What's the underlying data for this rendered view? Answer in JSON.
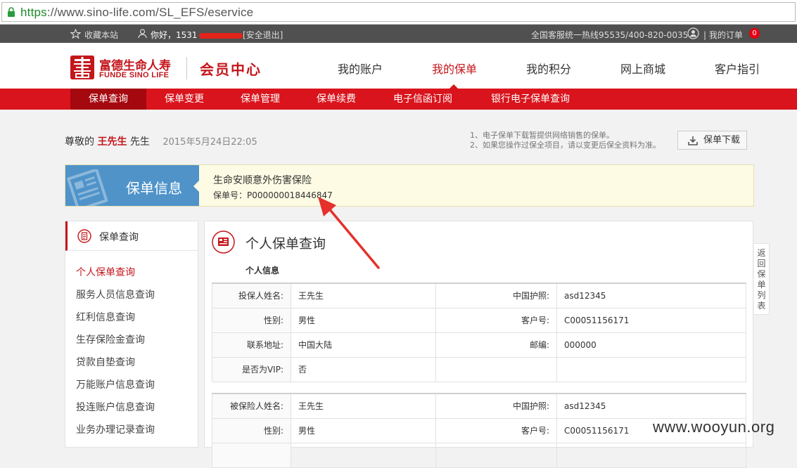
{
  "browser": {
    "url_scheme": "https",
    "url_rest": "://www.sino-life.com/SL_EFS/eservice"
  },
  "topbar": {
    "favorite": "收藏本站",
    "greeting": "你好，1531",
    "logout": "[安全退出]",
    "hotline": "全国客服统一热线95535/400-820-0035",
    "my_orders": "| 我的订单",
    "order_count": "0"
  },
  "header": {
    "logo_cn": "富德生命人寿",
    "logo_en": "FUNDE SINO LIFE",
    "member_center": "会员中心",
    "nav": [
      "我的账户",
      "我的保单",
      "我的积分",
      "网上商城",
      "客户指引"
    ]
  },
  "subnav": [
    "保单查询",
    "保单变更",
    "保单管理",
    "保单续费",
    "电子信函订阅",
    "银行电子保单查询"
  ],
  "greeting": {
    "prefix": "尊敬的",
    "name": "王先生",
    "suffix": "先生",
    "datetime": "2015年5月24日22:05"
  },
  "notes": [
    "1、电子保单下载暂提供网络销售的保单。",
    "2、如果您操作过保全项目，请以变更后保全资料为准。"
  ],
  "download_button": "保单下载",
  "banner": {
    "title": "保单信息",
    "product_name": "生命安顺意外伤害保险",
    "policy_no": "保单号：P000000018446847"
  },
  "sidebar": {
    "title": "保单查询",
    "links": [
      "个人保单查询",
      "服务人员信息查询",
      "红利信息查询",
      "生存保险金查询",
      "贷款自垫查询",
      "万能账户信息查询",
      "投连账户信息查询",
      "业务办理记录查询"
    ]
  },
  "main": {
    "title": "个人保单查询",
    "section": "个人信息",
    "holder_rows": [
      {
        "l1": "投保人姓名:",
        "v1": "王先生",
        "l2": "中国护照:",
        "v2": "asd12345"
      },
      {
        "l1": "性别:",
        "v1": "男性",
        "l2": "客户号:",
        "v2": "C00051156171"
      },
      {
        "l1": "联系地址:",
        "v1": "中国大陆",
        "l2": "邮编:",
        "v2": "000000"
      },
      {
        "l1": "是否为VIP:",
        "v1": "否",
        "l2": "",
        "v2": ""
      }
    ],
    "insured_rows": [
      {
        "l1": "被保险人姓名:",
        "v1": "王先生",
        "l2": "中国护照:",
        "v2": "asd12345"
      },
      {
        "l1": "性别:",
        "v1": "男性",
        "l2": "客户号:",
        "v2": "C00051156171"
      },
      {
        "l1": "",
        "v1": "",
        "l2": "",
        "v2": ""
      }
    ]
  },
  "return_tab": "返回保单列表",
  "watermark": "www.wooyun.org",
  "colors": {
    "brand_red": "#d9141c",
    "active_red": "#a5080e",
    "banner_blue": "#4f93c9"
  }
}
